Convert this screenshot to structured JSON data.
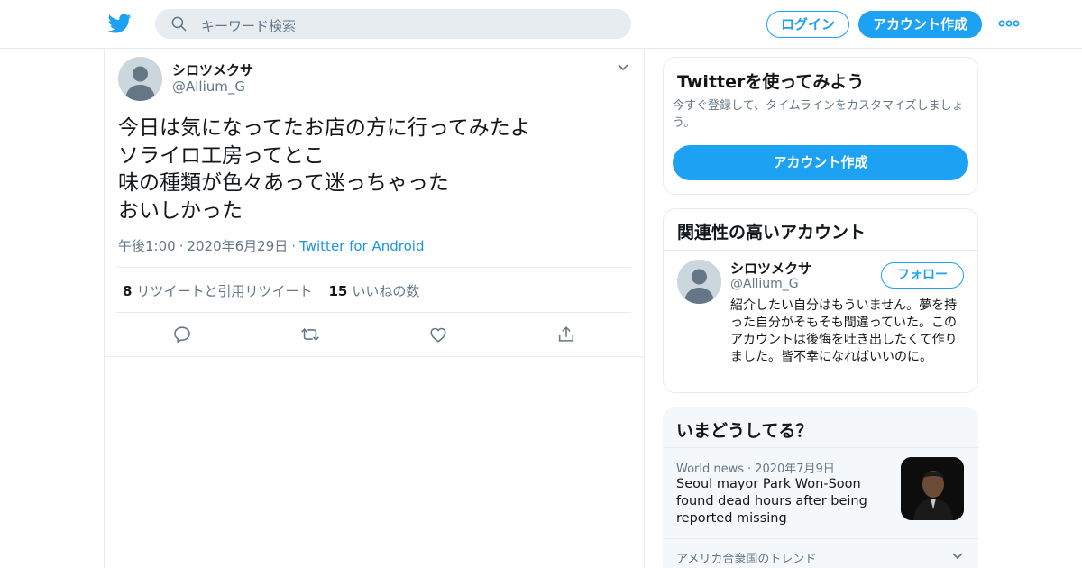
{
  "header": {
    "search_placeholder": "キーワード検索",
    "login_label": "ログイン",
    "signup_label": "アカウント作成",
    "brand_color": "#1da1f2"
  },
  "tweet": {
    "author_name": "シロツメクサ",
    "author_handle": "@Allium_G",
    "lines": [
      "今日は気になってたお店の方に行ってみたよ",
      "ソライロ工房ってとこ",
      "味の種類が色々あって迷っちゃった",
      "おいしかった"
    ],
    "time": "午後1:00",
    "date": "2020年6月29日",
    "source": "Twitter for Android",
    "retweet_count": "8",
    "retweet_label": "リツイートと引用リツイート",
    "like_count": "15",
    "like_label": "いいねの数",
    "actions": [
      "reply-icon",
      "retweet-icon",
      "like-icon",
      "share-icon"
    ]
  },
  "signup_card": {
    "title": "Twitterを使ってみよう",
    "description": "今すぐ登録して、タイムラインをカスタマイズしましょう。",
    "button_label": "アカウント作成"
  },
  "related_card": {
    "title": "関連性の高いアカウント",
    "account_name": "シロツメクサ",
    "account_handle": "@Allium_G",
    "follow_label": "フォロー",
    "bio": "紹介したい自分はもういません。夢を持った自分がそもそも間違っていた。このアカウントは後悔を吐き出したくて作りました。皆不幸になればいいのに。"
  },
  "happening_card": {
    "title": "いまどうしてる？",
    "news_category": "World news",
    "news_date": "2020年7月9日",
    "news_title": "Seoul mayor Park Won-Soon found dead hours after being reported missing",
    "trend_label": "アメリカ合衆国のトレンド"
  }
}
